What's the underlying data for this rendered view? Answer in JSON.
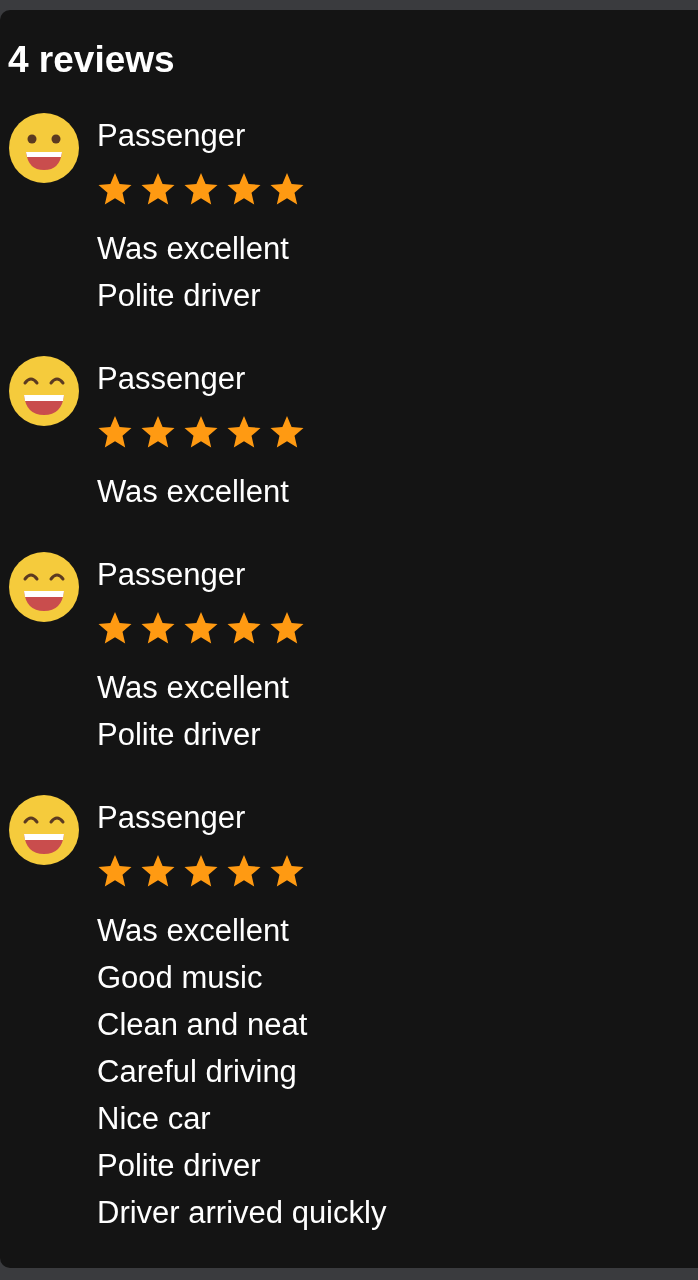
{
  "heading": "4 reviews",
  "reviews": [
    {
      "kind": "grinning",
      "author": "Passenger",
      "stars": 5,
      "comments": [
        "Was excellent",
        "Polite driver"
      ]
    },
    {
      "kind": "beaming",
      "author": "Passenger",
      "stars": 5,
      "comments": [
        "Was excellent"
      ]
    },
    {
      "kind": "beaming",
      "author": "Passenger",
      "stars": 5,
      "comments": [
        "Was excellent",
        "Polite driver"
      ]
    },
    {
      "kind": "beaming",
      "author": "Passenger",
      "stars": 5,
      "comments": [
        "Was excellent",
        "Good music",
        "Clean and neat",
        "Careful driving",
        "Nice car",
        "Polite driver",
        "Driver arrived quickly"
      ]
    }
  ]
}
